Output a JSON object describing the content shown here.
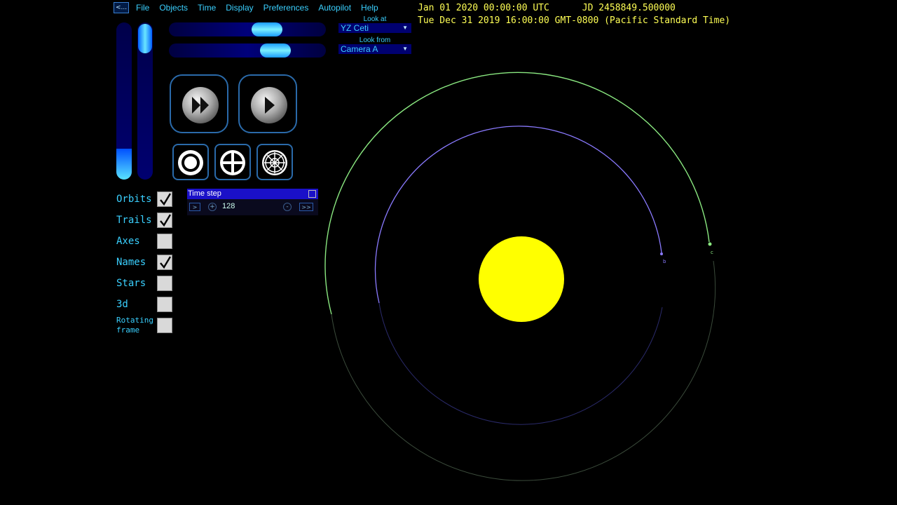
{
  "menu": {
    "back_label": "<...",
    "items": [
      "File",
      "Objects",
      "Time",
      "Display",
      "Preferences",
      "Autopilot",
      "Help"
    ]
  },
  "readout": {
    "utc": "Jan 01 2020 00:00:00 UTC      JD 2458849.500000",
    "local": "Tue Dec 31 2019 16:00:00 GMT-0800 (Pacific Standard Time)"
  },
  "look_at": {
    "label": "Look at",
    "value": "YZ Ceti"
  },
  "look_from": {
    "label": "Look from",
    "value": "Camera A"
  },
  "checkboxes": [
    {
      "label": "Orbits",
      "checked": true
    },
    {
      "label": "Trails",
      "checked": true
    },
    {
      "label": "Axes",
      "checked": false
    },
    {
      "label": "Names",
      "checked": true
    },
    {
      "label": "Stars",
      "checked": false
    },
    {
      "label": "3d",
      "checked": false
    },
    {
      "label": "Rotating frame",
      "checked": false
    }
  ],
  "time_step": {
    "title": "Time step",
    "value": "128",
    "forward_small": ">",
    "forward_fast": ">>",
    "plus": "+",
    "minus": "-"
  },
  "icons": {
    "fast_forward": "fast-forward-icon",
    "play": "play-icon",
    "target": "target-icon",
    "crosshair": "crosshair-icon",
    "wheel": "wheel-icon"
  },
  "colors": {
    "accent": "#3ad0ff",
    "readout": "#ffff55",
    "star": "#ffff00",
    "orbit_b": "#8a7aff",
    "orbit_c": "#7af070"
  },
  "planets": [
    {
      "name": "b"
    },
    {
      "name": "c"
    }
  ]
}
